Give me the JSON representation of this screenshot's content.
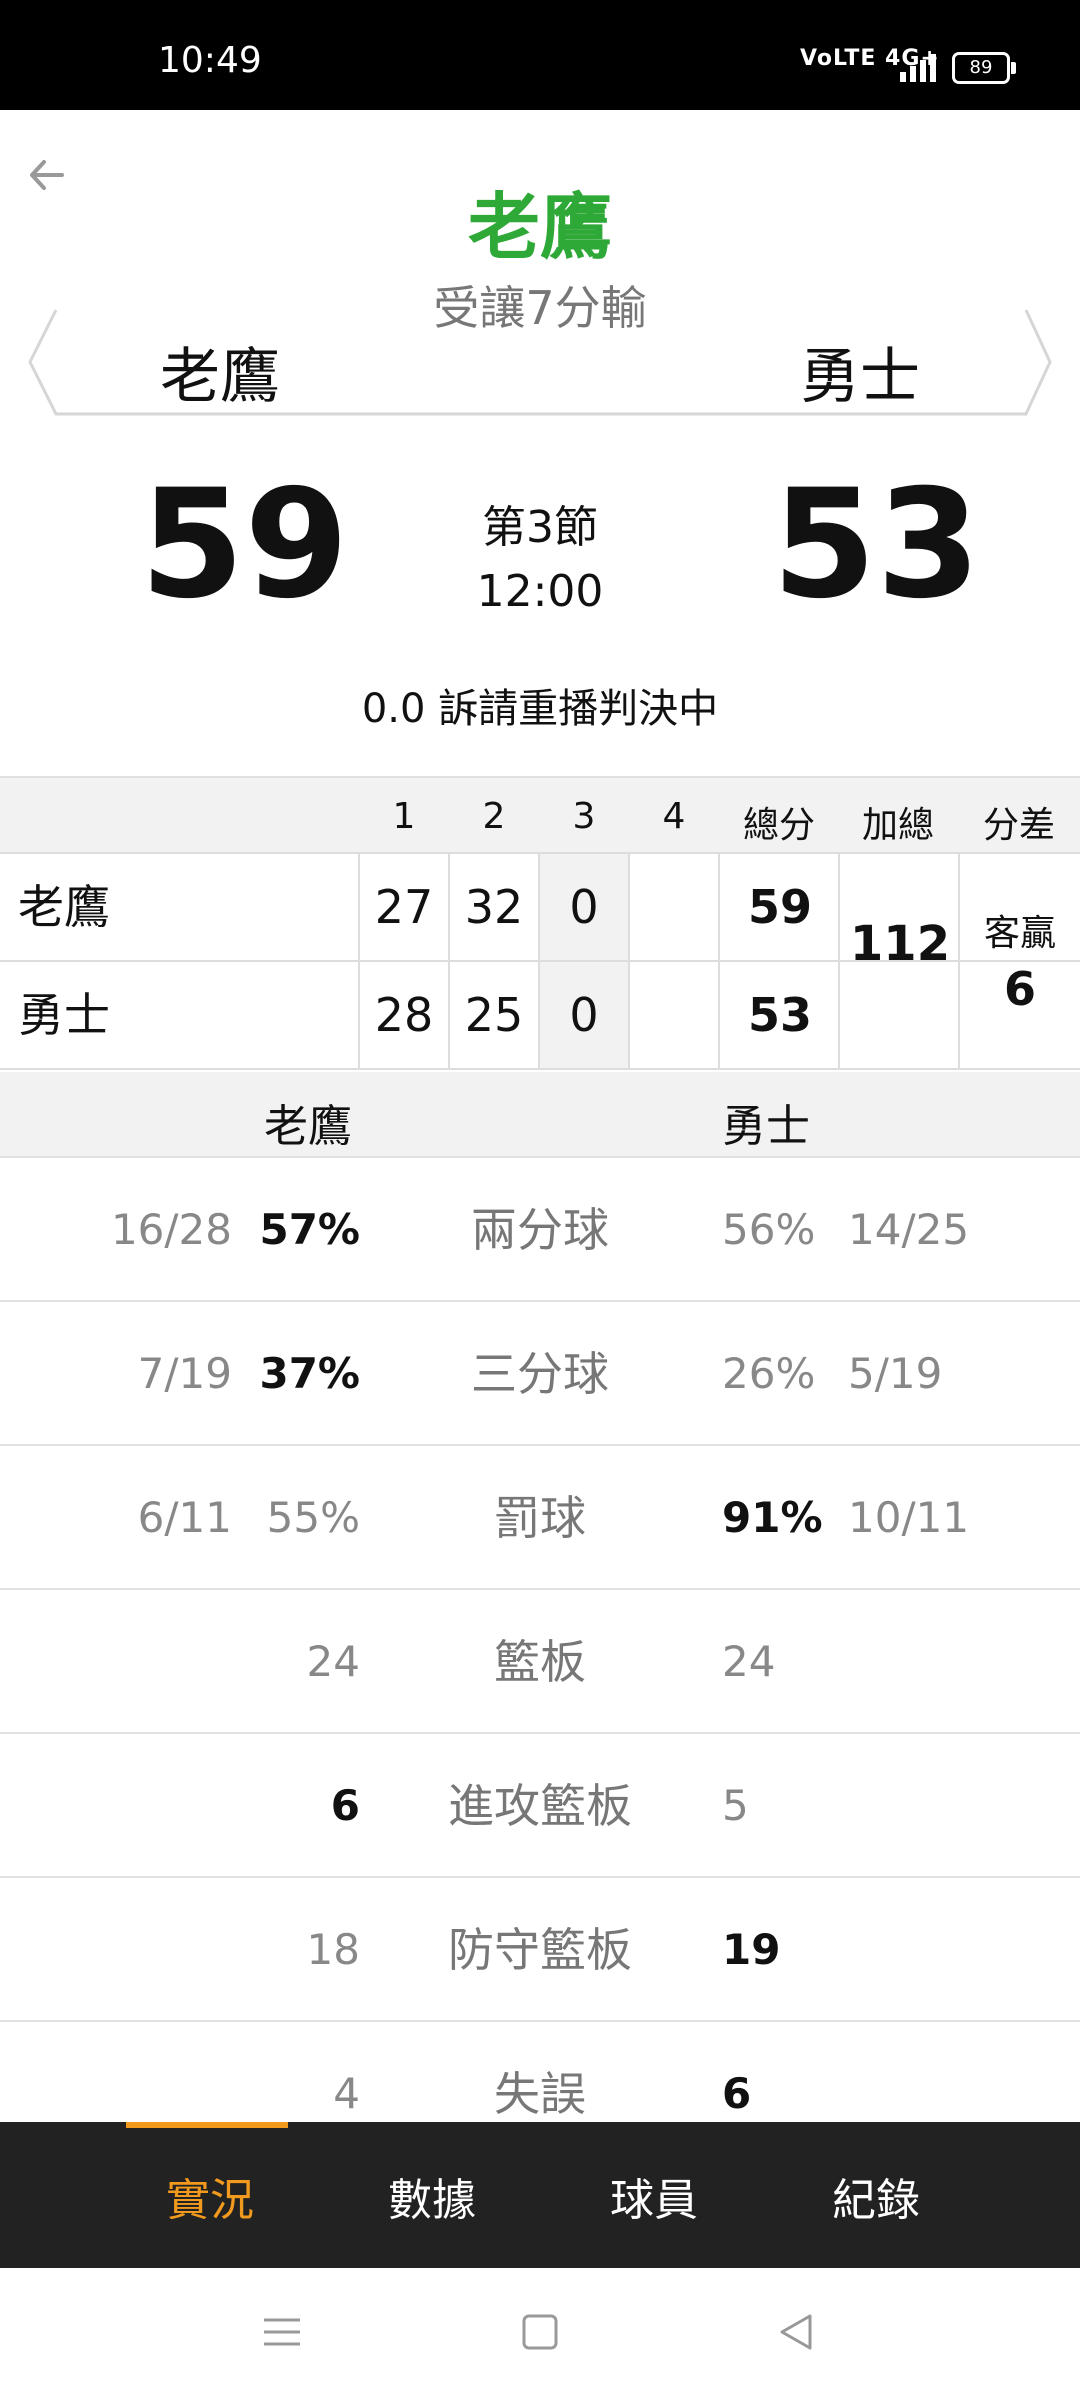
{
  "status_bar": {
    "time": "10:49",
    "network": "VoLTE 4G+",
    "battery": "89"
  },
  "header": {
    "title": "老鷹",
    "subtitle": "受讓7分輸",
    "home_team": "老鷹",
    "away_team": "勇士"
  },
  "score": {
    "home": "59",
    "away": "53",
    "period": "第3節",
    "clock": "12:00",
    "status": "0.0 訴請重播判決中"
  },
  "quarter_table": {
    "headers": [
      "1",
      "2",
      "3",
      "4",
      "總分",
      "加總",
      "分差"
    ],
    "rows": [
      {
        "team": "老鷹",
        "q": [
          "27",
          "32",
          "0",
          ""
        ],
        "total": "59"
      },
      {
        "team": "勇士",
        "q": [
          "28",
          "25",
          "0",
          ""
        ],
        "total": "53"
      }
    ],
    "combined": "112",
    "diff_label": "客贏",
    "diff_value": "6"
  },
  "stats": {
    "home_team": "老鷹",
    "away_team": "勇士",
    "rows": [
      {
        "label": "兩分球",
        "home_frac": "16/28",
        "home": "57%",
        "away": "56%",
        "away_frac": "14/25",
        "lead": "home"
      },
      {
        "label": "三分球",
        "home_frac": "7/19",
        "home": "37%",
        "away": "26%",
        "away_frac": "5/19",
        "lead": "home"
      },
      {
        "label": "罰球",
        "home_frac": "6/11",
        "home": "55%",
        "away": "91%",
        "away_frac": "10/11",
        "lead": "away"
      },
      {
        "label": "籃板",
        "home_frac": "",
        "home": "24",
        "away": "24",
        "away_frac": "",
        "lead": "none"
      },
      {
        "label": "進攻籃板",
        "home_frac": "",
        "home": "6",
        "away": "5",
        "away_frac": "",
        "lead": "home"
      },
      {
        "label": "防守籃板",
        "home_frac": "",
        "home": "18",
        "away": "19",
        "away_frac": "",
        "lead": "away"
      },
      {
        "label": "失誤",
        "home_frac": "",
        "home": "4",
        "away": "6",
        "away_frac": "",
        "lead": "away"
      }
    ]
  },
  "tabs": [
    {
      "label": "實況",
      "active": true
    },
    {
      "label": "數據",
      "active": false
    },
    {
      "label": "球員",
      "active": false
    },
    {
      "label": "紀錄",
      "active": false
    }
  ],
  "colors": {
    "accent": "#f29a1d",
    "title_green": "#2ea836",
    "tabbar": "#222222"
  }
}
